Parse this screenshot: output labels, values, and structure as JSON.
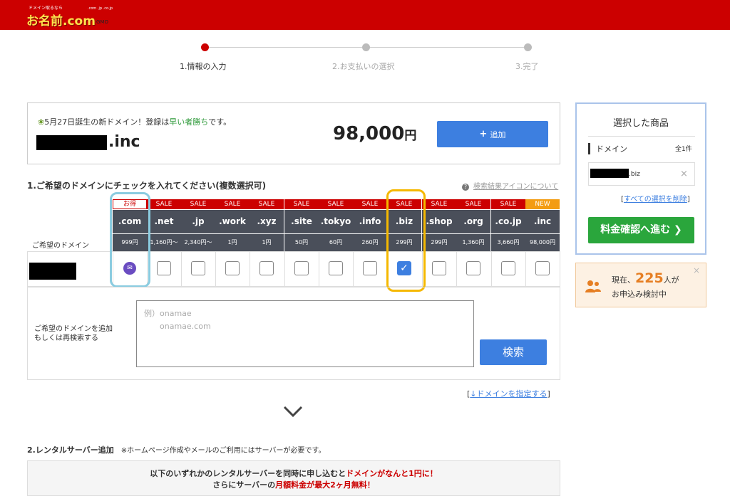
{
  "header": {
    "logo_tagline": "ドメイン取るなら",
    "logo_main": "お名前.com",
    "logo_sub": ".com .jp .co.jp",
    "logo_gmo": "GMO"
  },
  "steps": [
    {
      "label": "1.情報の入力",
      "active": true
    },
    {
      "label": "2.お支払いの選択",
      "active": false
    },
    {
      "label": "3.完了",
      "active": false
    }
  ],
  "promo": {
    "message_pre": "5月27日誕生の新ドメイン！登録は",
    "message_highlight": "早い者勝ち",
    "message_post": "です。",
    "tld": ".inc",
    "price_number": "98,000",
    "price_unit": "円",
    "add_plus": "+",
    "add_label": "追加"
  },
  "section1": {
    "title": "1.ご希望のドメインにチェックを入れてください(複数選択可)",
    "help_link": "検索結果アイコンについて",
    "row_label": "ご希望のドメイン"
  },
  "domains": [
    {
      "badge": "お得",
      "name": ".com",
      "price": "999円",
      "state": "mail"
    },
    {
      "badge": "SALE",
      "name": ".net",
      "price": "1,160円～",
      "state": "unchecked"
    },
    {
      "badge": "SALE",
      "name": ".jp",
      "price": "2,340円～",
      "state": "unchecked"
    },
    {
      "badge": "SALE",
      "name": ".work",
      "price": "1円",
      "state": "unchecked"
    },
    {
      "badge": "SALE",
      "name": ".xyz",
      "price": "1円",
      "state": "unchecked"
    },
    {
      "badge": "SALE",
      "name": ".site",
      "price": "50円",
      "state": "unchecked"
    },
    {
      "badge": "SALE",
      "name": ".tokyo",
      "price": "60円",
      "state": "unchecked"
    },
    {
      "badge": "SALE",
      "name": ".info",
      "price": "260円",
      "state": "unchecked"
    },
    {
      "badge": "SALE",
      "name": ".biz",
      "price": "299円",
      "state": "checked"
    },
    {
      "badge": "SALE",
      "name": ".shop",
      "price": "299円",
      "state": "unchecked"
    },
    {
      "badge": "SALE",
      "name": ".org",
      "price": "1,360円",
      "state": "unchecked"
    },
    {
      "badge": "SALE",
      "name": ".co.jp",
      "price": "3,660円",
      "state": "unchecked"
    },
    {
      "badge": "NEW",
      "name": ".inc",
      "price": "98,000円",
      "state": "unchecked"
    }
  ],
  "add_search": {
    "label": "ご希望のドメインを追加\nもしくは再検索する",
    "placeholder": "例）onamae\n　　onamae.com",
    "button": "検索"
  },
  "domain_link": {
    "bracket_open": "[",
    "text": "↓ドメインを指定する",
    "bracket_close": "]"
  },
  "section2": {
    "title": "2.レンタルサーバー追加",
    "note": "※ホームページ作成やメールのご利用にはサーバーが必要です。",
    "banner_line1_pre": "以下のいずれかのレンタルサーバーを同時に申し込むと",
    "banner_line1_red": "ドメインがなんと1円に！",
    "banner_line2_pre": "さらにサーバーの",
    "banner_line2_red": "月額料金が最大2ヶ月無料！"
  },
  "sidebar": {
    "title": "選択した商品",
    "domain_label": "ドメイン",
    "count": "全1件",
    "item_tld": ".biz",
    "remove": "×",
    "clear_open": "[",
    "clear_text": "すべての選択を削除",
    "clear_close": "]",
    "confirm_label": "料金確認へ進む ❯"
  },
  "viewers": {
    "prefix": "現在、",
    "count": "225",
    "suffix": "人が",
    "line2": "お申込み検討中",
    "close": "×"
  },
  "colors": {
    "brand_red": "#cc0000",
    "accent_blue": "#3d7fe0",
    "confirm_green": "#2aa63c",
    "highlight_blue": "#8bcce0",
    "highlight_yellow": "#f5b800"
  }
}
